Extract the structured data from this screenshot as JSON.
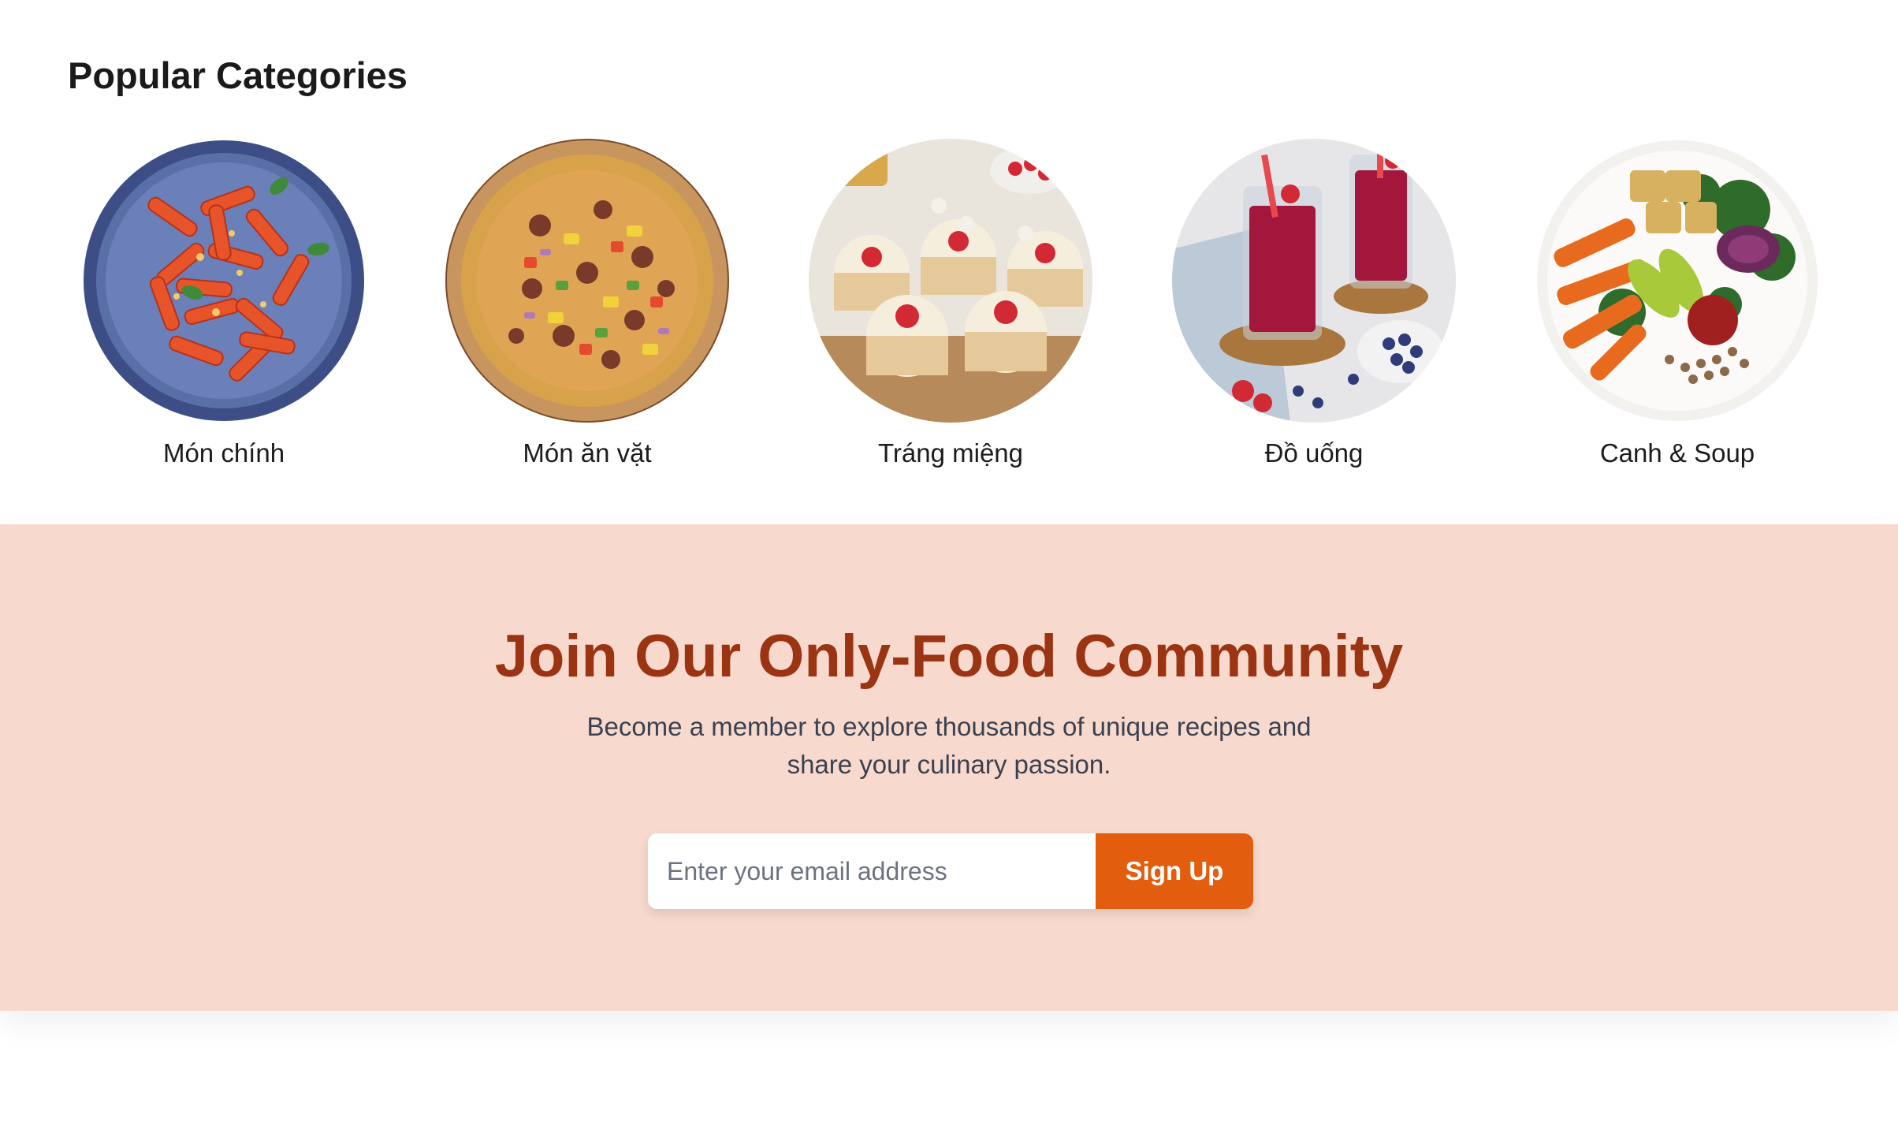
{
  "categories_section": {
    "title": "Popular Categories",
    "items": [
      {
        "label": "Món chính",
        "image": "pasta-dish"
      },
      {
        "label": "Món ăn vặt",
        "image": "pizza"
      },
      {
        "label": "Tráng miệng",
        "image": "strawberry-cakes"
      },
      {
        "label": "Đồ uống",
        "image": "berry-smoothies"
      },
      {
        "label": "Canh & Soup",
        "image": "veggie-bowl"
      }
    ]
  },
  "join_section": {
    "title": "Join Our Only-Food Community",
    "description": "Become a member to explore thousands of unique recipes and share your culinary passion.",
    "email_placeholder": "Enter your email address",
    "signup_label": "Sign Up"
  },
  "colors": {
    "accent": "#e35d0e",
    "heading": "#9a3412",
    "join_background": "#f8d9cd"
  }
}
